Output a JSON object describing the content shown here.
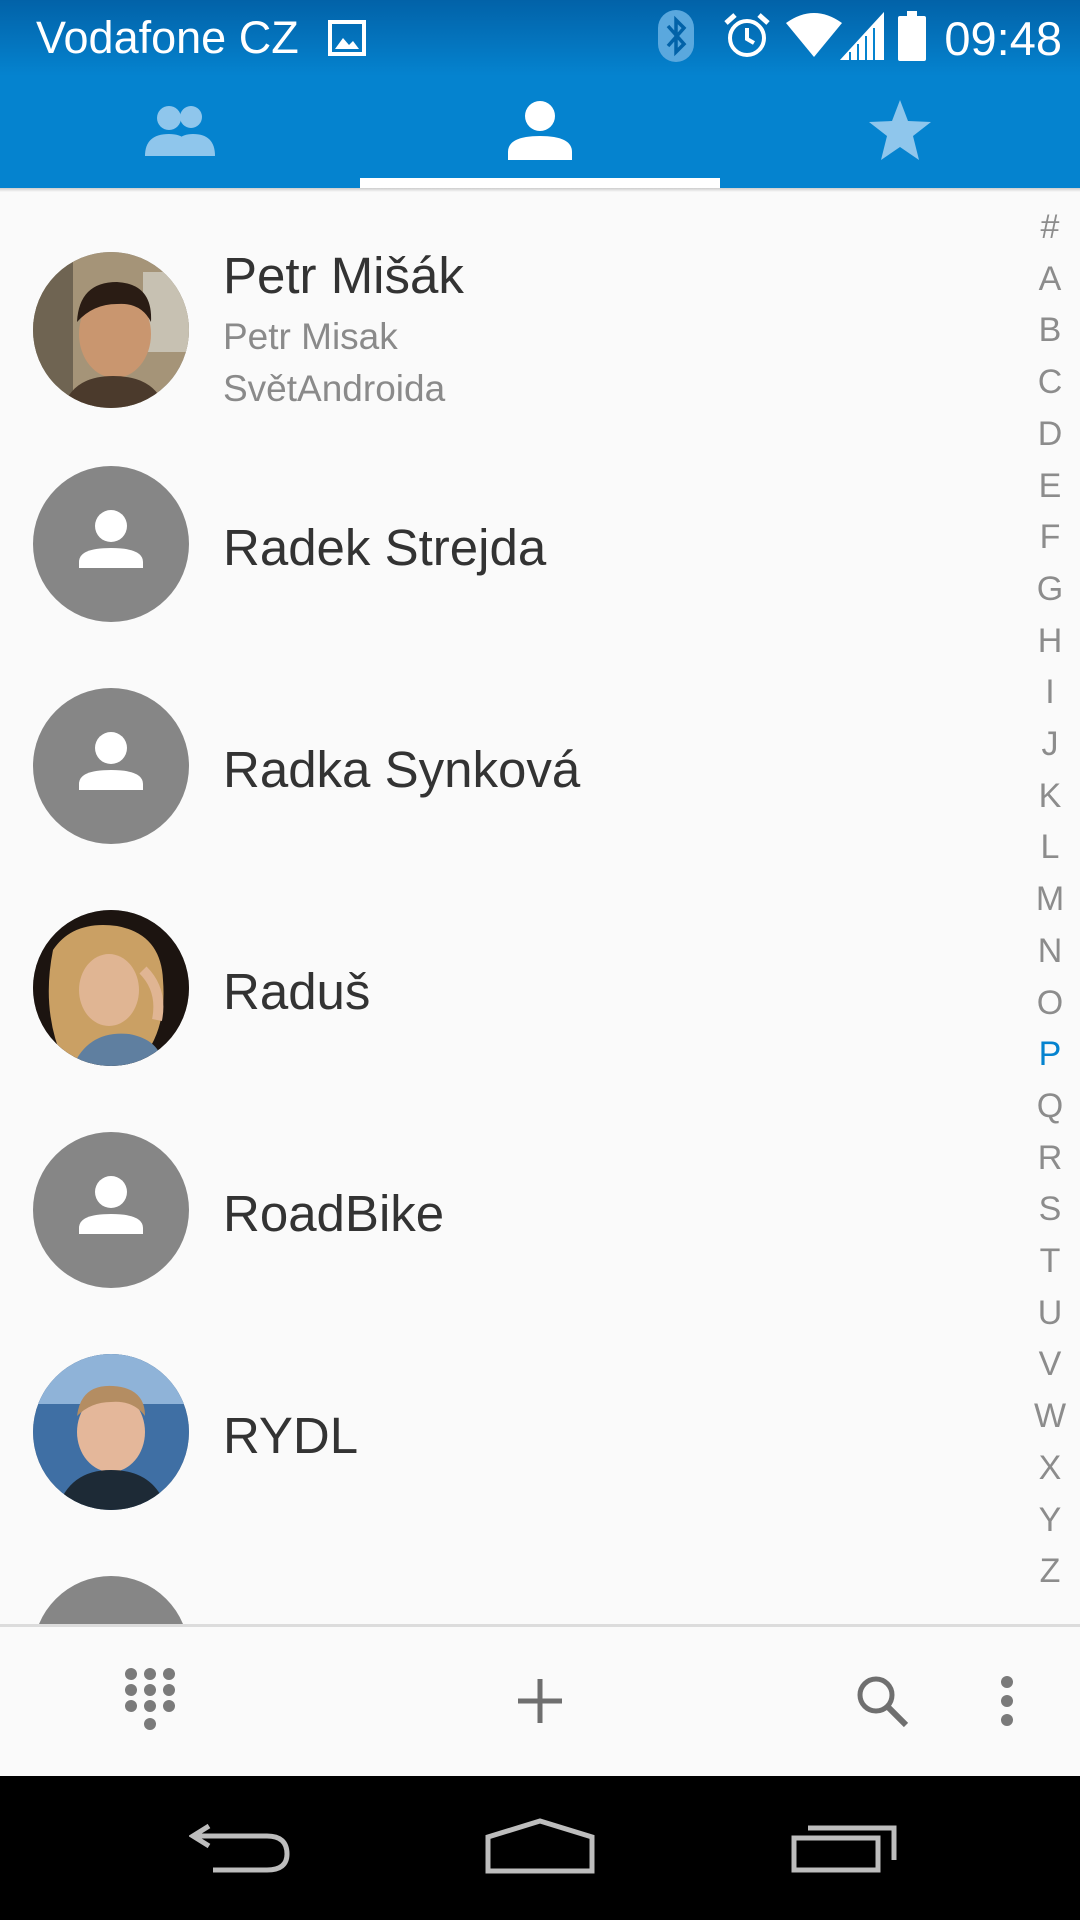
{
  "status_bar": {
    "carrier": "Vodafone CZ",
    "time": "09:48",
    "icons": [
      "image-icon",
      "bluetooth-icon",
      "alarm-icon",
      "wifi-icon",
      "cell-signal-icon",
      "battery-icon"
    ]
  },
  "tabs": [
    {
      "name": "groups",
      "icon": "groups-icon",
      "selected": false
    },
    {
      "name": "all-contacts",
      "icon": "person-icon",
      "selected": true
    },
    {
      "name": "favorites",
      "icon": "star-icon",
      "selected": false
    }
  ],
  "contacts": [
    {
      "name": "Petr Mišák",
      "line2": "Petr Misak",
      "line3": "SvětAndroida",
      "avatar": "photo"
    },
    {
      "name": "Radek Strejda",
      "avatar": "default"
    },
    {
      "name": "Radka Synková",
      "avatar": "default"
    },
    {
      "name": "Raduš",
      "avatar": "photo"
    },
    {
      "name": "RoadBike",
      "avatar": "default"
    },
    {
      "name": "RYDL",
      "avatar": "photo"
    }
  ],
  "index": {
    "letters": [
      "#",
      "A",
      "B",
      "C",
      "D",
      "E",
      "F",
      "G",
      "H",
      "I",
      "J",
      "K",
      "L",
      "M",
      "N",
      "O",
      "P",
      "Q",
      "R",
      "S",
      "T",
      "U",
      "V",
      "W",
      "X",
      "Y",
      "Z"
    ],
    "active": "P"
  },
  "action_bar": [
    "dialpad-icon",
    "add-icon",
    "search-icon",
    "overflow-menu-icon"
  ],
  "nav_bar": [
    "back-icon",
    "home-icon",
    "recents-icon"
  ],
  "colors": {
    "accent": "#0583cf",
    "status_bar": "#0262a8",
    "default_avatar": "#868686",
    "text": "#333333",
    "secondary_text": "#8a8a8a"
  }
}
